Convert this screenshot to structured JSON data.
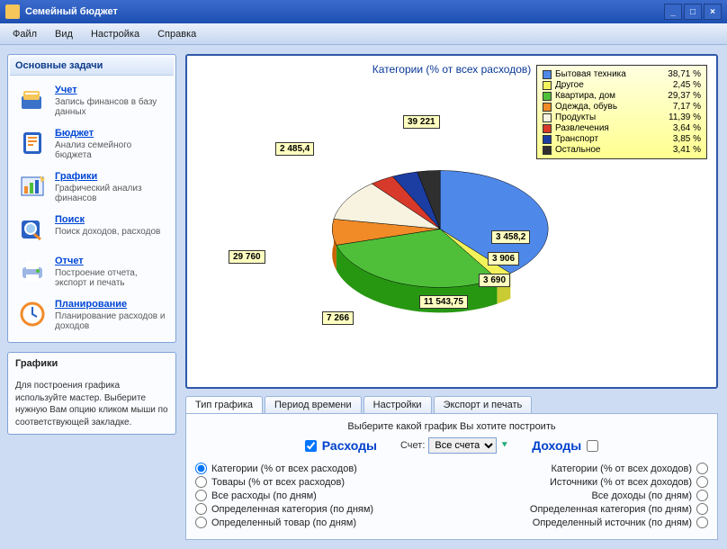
{
  "window": {
    "title": "Семейный бюджет",
    "minimize": "_",
    "maximize": "□",
    "close": "×"
  },
  "menu": {
    "file": "Файл",
    "view": "Вид",
    "settings": "Настройка",
    "help": "Справка"
  },
  "sidebar": {
    "title": "Основные задачи",
    "items": [
      {
        "title": "Учет",
        "desc": "Запись финансов в базу данных"
      },
      {
        "title": "Бюджет",
        "desc": "Анализ семейного бюджета"
      },
      {
        "title": "Графики",
        "desc": "Графический анализ финансов"
      },
      {
        "title": "Поиск",
        "desc": "Поиск доходов, расходов"
      },
      {
        "title": "Отчет",
        "desc": "Построение отчета, экспорт и печать"
      },
      {
        "title": "Планирование",
        "desc": "Планирование расходов и доходов"
      }
    ],
    "helpTitle": "Графики",
    "helpText": "Для построения графика используйте мастер. Выберите нужную Вам опцию кликом мыши по соответствующей закладке."
  },
  "chart_data": {
    "type": "pie",
    "title": "Категории (% от всех расходов)",
    "series": [
      {
        "name": "Бытовая техника",
        "percent": 38.71,
        "value": 39221,
        "color": "#4e88e9"
      },
      {
        "name": "Другое",
        "percent": 2.45,
        "value": 2485.4,
        "color": "#f2f25a"
      },
      {
        "name": "Квартира, дом",
        "percent": 29.37,
        "value": 29760,
        "color": "#4fbf3a"
      },
      {
        "name": "Одежда, обувь",
        "percent": 7.17,
        "value": 7266,
        "color": "#f08b28"
      },
      {
        "name": "Продукты",
        "percent": 11.39,
        "value": 11543.75,
        "color": "#f7f3e0"
      },
      {
        "name": "Развлечения",
        "percent": 3.64,
        "value": 3690,
        "color": "#d73a2a"
      },
      {
        "name": "Транспорт",
        "percent": 3.85,
        "value": 3906,
        "color": "#1c3da2"
      },
      {
        "name": "Остальное",
        "percent": 3.41,
        "value": 3458.2,
        "color": "#2f2f2f"
      }
    ],
    "callouts": {
      "c0": "39 221",
      "c1": "2 485,4",
      "c2": "29 760",
      "c3": "7 266",
      "c4": "11 543,75",
      "c5": "3 690",
      "c6": "3 906",
      "c7": "3 458,2"
    },
    "legend": {
      "p0": "38,71 %",
      "p1": "2,45 %",
      "p2": "29,37 %",
      "p3": "7,17 %",
      "p4": "11,39 %",
      "p5": "3,64 %",
      "p6": "3,85 %",
      "p7": "3,41 %"
    }
  },
  "tabs": {
    "t0": "Тип графика",
    "t1": "Период времени",
    "t2": "Настройки",
    "t3": "Экспорт и печать"
  },
  "controls": {
    "prompt": "Выберите какой график Вы хотите построить",
    "expenses": "Расходы",
    "incomes": "Доходы",
    "accountLabel": "Счет:",
    "accountValue": "Все счета",
    "left": {
      "o0": "Категории (% от всех расходов)",
      "o1": "Товары (% от всех расходов)",
      "o2": "Все расходы (по дням)",
      "o3": "Определенная категория (по дням)",
      "o4": "Определенный товар (по дням)"
    },
    "right": {
      "o0": "Категории (% от всех доходов)",
      "o1": "Источники (% от всех доходов)",
      "o2": "Все доходы (по дням)",
      "o3": "Определенная категория (по дням)",
      "o4": "Определенный источник (по дням)"
    }
  }
}
